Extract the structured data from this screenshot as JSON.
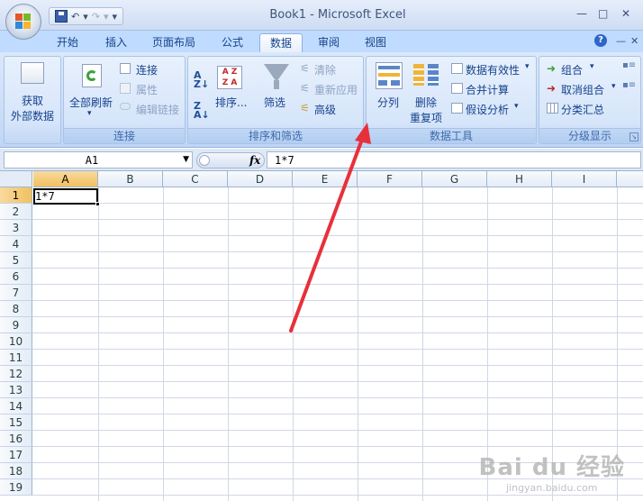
{
  "window": {
    "title": "Book1 - Microsoft Excel",
    "controls": [
      "—",
      "□",
      "✕"
    ]
  },
  "qat": {
    "more": "▾"
  },
  "tabs": [
    {
      "label": "开始",
      "active": false
    },
    {
      "label": "插入",
      "active": false
    },
    {
      "label": "页面布局",
      "active": false
    },
    {
      "label": "公式",
      "active": false
    },
    {
      "label": "数据",
      "active": true
    },
    {
      "label": "审阅",
      "active": false
    },
    {
      "label": "视图",
      "active": false
    }
  ],
  "ribbon": {
    "get_external": {
      "label1": "获取",
      "label2": "外部数据"
    },
    "connections": {
      "group_label": "连接",
      "refresh_all": "全部刷新",
      "connections": "连接",
      "properties": "属性",
      "edit_links": "编辑链接"
    },
    "sort_filter": {
      "group_label": "排序和筛选",
      "sort": "排序...",
      "filter": "筛选",
      "clear": "清除",
      "reapply": "重新应用",
      "advanced": "高级"
    },
    "data_tools": {
      "group_label": "数据工具",
      "text_to_columns": "分列",
      "remove_dup1": "删除",
      "remove_dup2": "重复项",
      "validation": "数据有效性",
      "consolidate": "合并计算",
      "what_if": "假设分析"
    },
    "outline": {
      "group_label": "分级显示",
      "group": "组合",
      "ungroup": "取消组合",
      "subtotal": "分类汇总"
    }
  },
  "formula_bar": {
    "name_box": "A1",
    "fx": "fx",
    "content": "1*7"
  },
  "sheet": {
    "columns": [
      "A",
      "B",
      "C",
      "D",
      "E",
      "F",
      "G",
      "H",
      "I"
    ],
    "rows": [
      "1",
      "2",
      "3",
      "4",
      "5",
      "6",
      "7",
      "8",
      "9",
      "10",
      "11",
      "12",
      "13",
      "14",
      "15",
      "16",
      "17",
      "18",
      "19"
    ],
    "active_cell": "A1",
    "a1_value": "1*7"
  },
  "watermark": {
    "line1": "Bai du 经验",
    "line2": "jingyan.baidu.com"
  },
  "colors": {
    "ribbon": "#c9dcf6",
    "tab_bar": "#bfdbff",
    "arrow": "#e8303a"
  }
}
